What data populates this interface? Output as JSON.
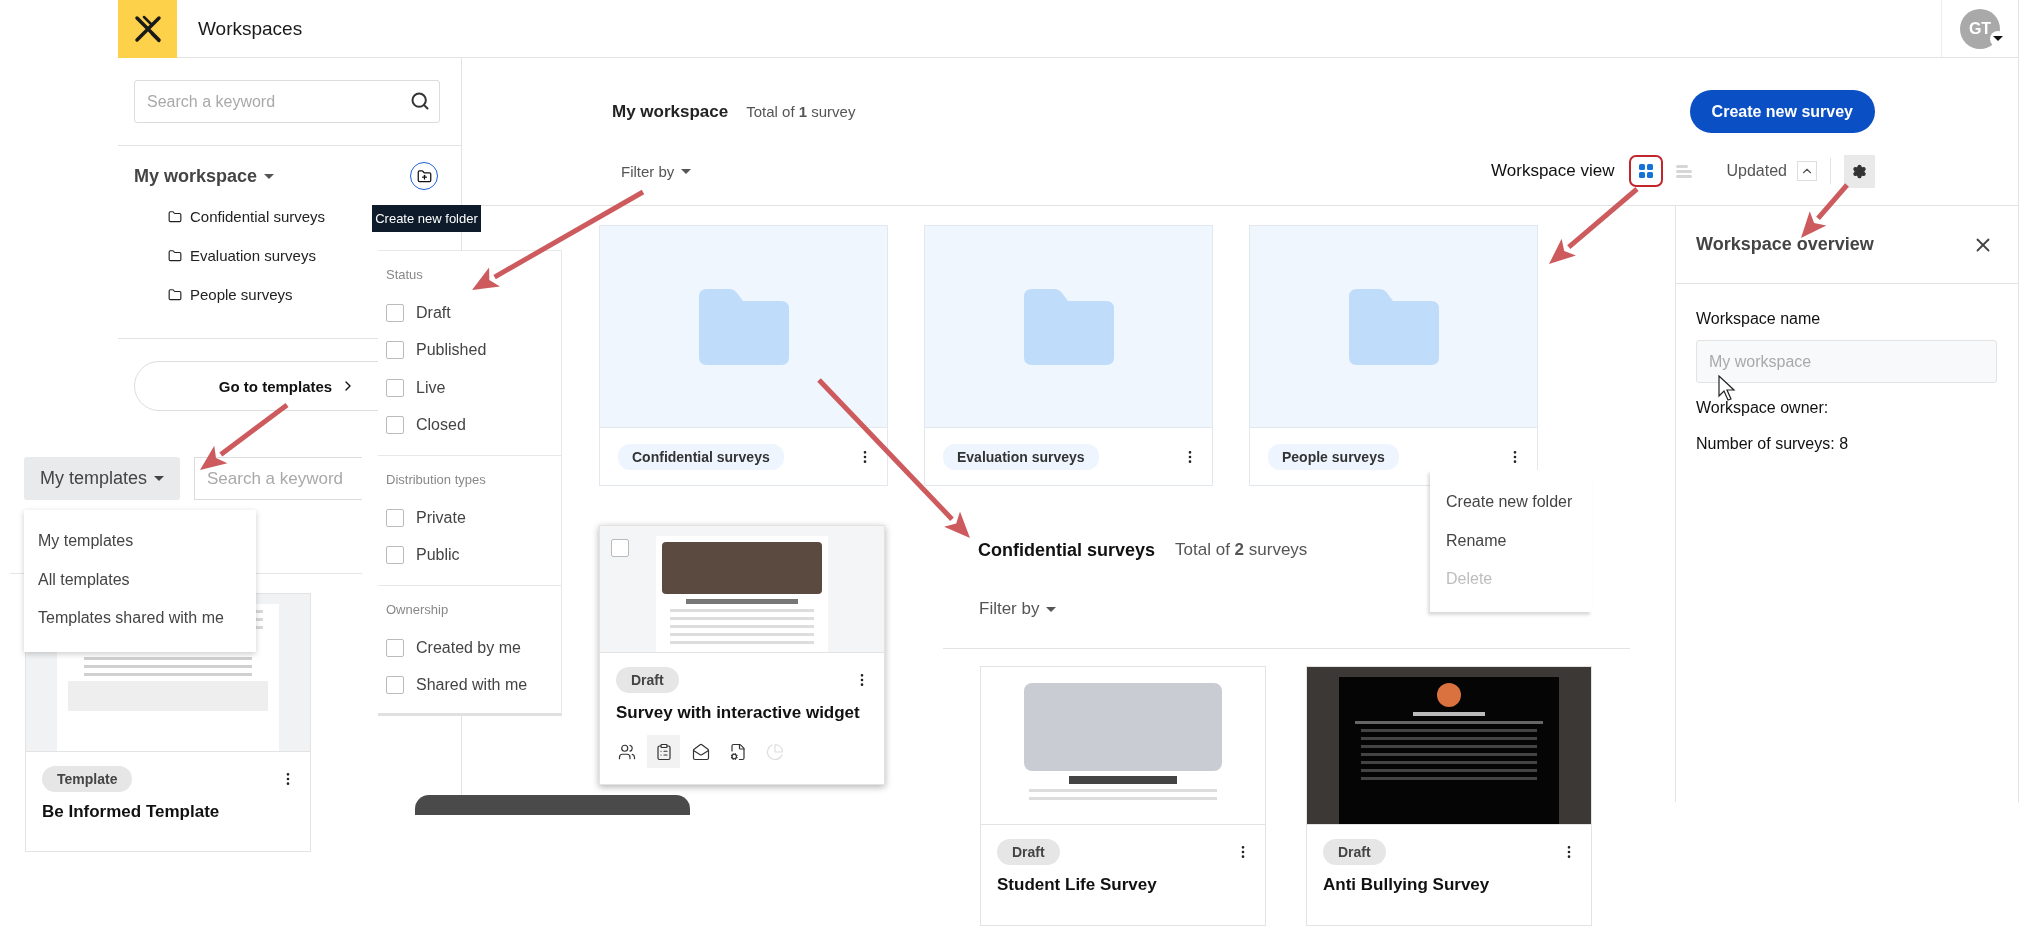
{
  "app_bar": {
    "title": "Workspaces",
    "avatar": "GT"
  },
  "sidebar": {
    "search": {
      "placeholder": "Search a keyword"
    },
    "workspace": "My workspace",
    "new_folder_tooltip": "Create new folder",
    "folders": [
      "Confidential surveys",
      "Evaluation surveys",
      "People surveys"
    ],
    "templates_button": "Go to templates"
  },
  "templates_panel": {
    "dropdown": "My templates",
    "search": {
      "placeholder": "Search a keyword"
    },
    "menu": [
      "My templates",
      "All templates",
      "Templates shared with me"
    ],
    "card": {
      "kind": "document",
      "badge": "Template",
      "title": "Be Informed Template"
    }
  },
  "filter_panel": {
    "groups": [
      {
        "title": "Status",
        "options": [
          {
            "label": "Draft",
            "checked": false
          },
          {
            "label": "Published",
            "checked": false
          },
          {
            "label": "Live",
            "checked": false
          },
          {
            "label": "Closed",
            "checked": false
          }
        ]
      },
      {
        "title": "Distribution types",
        "options": [
          {
            "label": "Private",
            "checked": false
          },
          {
            "label": "Public",
            "checked": false
          }
        ]
      },
      {
        "title": "Ownership",
        "options": [
          {
            "label": "Created by me",
            "checked": false
          },
          {
            "label": "Shared with me",
            "checked": false
          }
        ]
      }
    ]
  },
  "workspace": {
    "title": "My workspace",
    "total": "Total of **1** survey",
    "create_button": "Create new survey",
    "filter": "Filter by",
    "view_label": "Workspace view",
    "views": [
      {
        "kind": "grid",
        "selected": true
      },
      {
        "kind": "list",
        "selected": false
      }
    ],
    "sort": "Updated",
    "folders": [
      "Confidential surveys",
      "Evaluation surveys",
      "People surveys"
    ]
  },
  "folder_menu": [
    {
      "label": "Create new folder",
      "disabled": false
    },
    {
      "label": "Rename",
      "disabled": false
    },
    {
      "label": "Delete",
      "disabled": true
    }
  ],
  "overview": {
    "title": "Workspace overview",
    "name_label": "Workspace name",
    "name_placeholder": "My workspace",
    "owner": "Workspace owner:",
    "count": "Number of surveys: 8"
  },
  "floating_card": {
    "kind": "team-photo",
    "checked": false,
    "badge": "Draft",
    "title": "Survey with interactive widget",
    "actions": [
      {
        "kind": "people",
        "highlighted": false,
        "disabled": false
      },
      {
        "kind": "clipboard",
        "highlighted": true,
        "disabled": false
      },
      {
        "kind": "mail",
        "highlighted": false,
        "disabled": false
      },
      {
        "kind": "file-settings",
        "highlighted": false,
        "disabled": false
      },
      {
        "kind": "pie",
        "highlighted": false,
        "disabled": true
      }
    ]
  },
  "folder_view": {
    "title": "Confidential surveys",
    "total": "Total of **2** surveys",
    "filter": "Filter by",
    "surveys": [
      {
        "kind": "light",
        "badge": "Draft",
        "title": "Student Life Survey"
      },
      {
        "kind": "dark",
        "badge": "Draft",
        "title": "Anti Bullying Survey"
      }
    ]
  }
}
